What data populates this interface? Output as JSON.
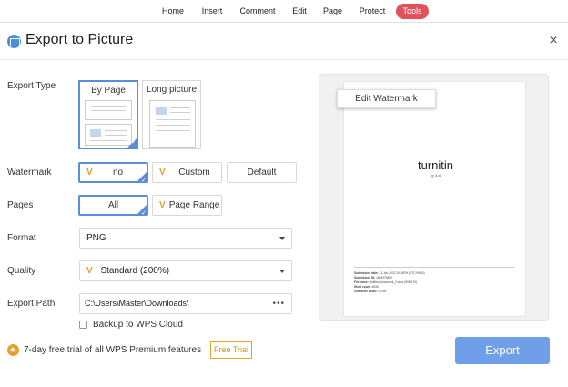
{
  "menu": {
    "items": [
      {
        "label": "Home"
      },
      {
        "label": "Insert"
      },
      {
        "label": "Comment"
      },
      {
        "label": "Edit"
      },
      {
        "label": "Page"
      },
      {
        "label": "Protect"
      },
      {
        "label": "Tools",
        "active": true
      }
    ]
  },
  "dialog": {
    "title": "Export to Picture",
    "close_glyph": "×"
  },
  "export_type": {
    "label": "Export Type",
    "options": [
      "By Page",
      "Long picture"
    ],
    "selected": "By Page"
  },
  "watermark": {
    "label": "Watermark",
    "options": [
      "no",
      "Custom",
      "Default"
    ],
    "selected": "no",
    "vip_mark": "V"
  },
  "pages": {
    "label": "Pages",
    "options": [
      "All",
      "Page Range"
    ],
    "selected": "All",
    "vip_mark": "V"
  },
  "format": {
    "label": "Format",
    "value": "PNG"
  },
  "quality": {
    "label": "Quality",
    "value": "Standard (200%)",
    "vip_mark": "V"
  },
  "export_path": {
    "label": "Export Path",
    "value": "C:\\Users\\Master\\Downloads\\",
    "more_glyph": "•••"
  },
  "backup": {
    "label": "Backup to WPS Cloud",
    "checked": false
  },
  "premium": {
    "text": "7-day free trial of all WPS Premium features",
    "trial_label": "Free Trial"
  },
  "preview": {
    "edit_watermark_label": "Edit Watermark",
    "brand": "turnitin",
    "brand_sub": "by A A",
    "meta": [
      {
        "key": "Submission date:",
        "value": "13-Jun-2022 10:48PM (UTC+0800)"
      },
      {
        "key": "Submission ID:",
        "value": "1853976460"
      },
      {
        "key": "File name:",
        "value": "Untitled_document_2.docx (508.47K)"
      },
      {
        "key": "Word count:",
        "value": "4638"
      },
      {
        "key": "Character count:",
        "value": "27099"
      }
    ]
  },
  "export_button": {
    "label": "Export"
  },
  "colors": {
    "accent": "#5b8ed6",
    "export_button": "#6e9fe8",
    "active_tab": "#e0525b",
    "premium": "#e4a12a"
  }
}
